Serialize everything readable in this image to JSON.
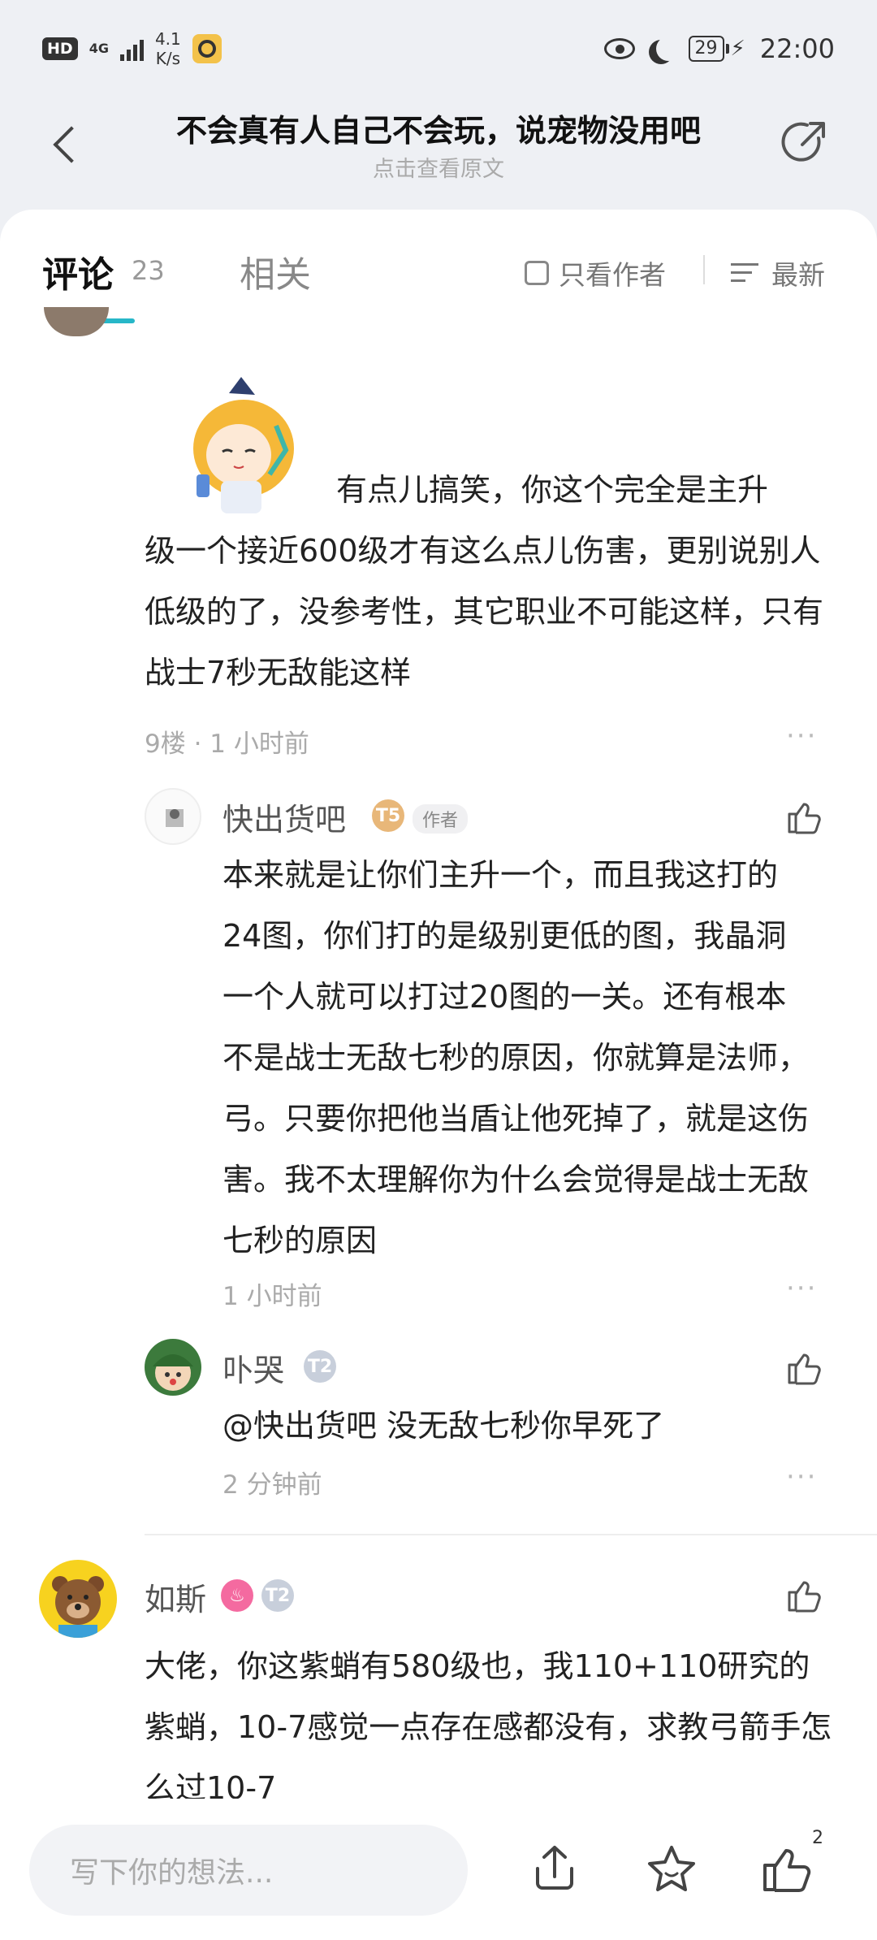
{
  "status": {
    "hd": "HD",
    "network": "4G",
    "speed_value": "4.1",
    "speed_unit": "K/s",
    "battery": "29",
    "time": "22:00"
  },
  "header": {
    "title": "不会真有人自己不会玩，说宠物没用吧",
    "subtitle": "点击查看原文"
  },
  "tabs": {
    "comments_label": "评论",
    "comments_count": "23",
    "related_label": "相关",
    "only_author_label": "只看作者",
    "sort_label": "最新"
  },
  "comment9": {
    "text_line1": "有点儿搞笑，你这个完全是主升",
    "text_rest": "级一个接近600级才有这么点儿伤害，更别说别人低级的了，没参考性，其它职业不可能这样，只有战士7秒无敌能这样",
    "meta": "9楼 · 1 小时前"
  },
  "reply1": {
    "username": "快出货吧",
    "level_badge": "T5",
    "author_badge": "作者",
    "text": "本来就是让你们主升一个，而且我这打的24图，你们打的是级别更低的图，我晶洞一个人就可以打过20图的一关。还有根本不是战士无敌七秒的原因，你就算是法师，弓。只要你把他当盾让他死掉了，就是这伤害。我不太理解你为什么会觉得是战士无敌七秒的原因",
    "meta": "1 小时前"
  },
  "reply2": {
    "username": "卟哭",
    "level_badge": "T2",
    "text": "@快出货吧  没无敌七秒你早死了",
    "meta": "2 分钟前"
  },
  "comment10": {
    "username": "如斯",
    "level_badge": "T2",
    "text": "大佬，你这紫蛸有580级也，我110+110研究的紫蛸，10-7感觉一点存在感都没有，求教弓箭手怎么过10-7"
  },
  "bottom": {
    "input_placeholder": "写下你的想法...",
    "like_count": "2"
  },
  "colors": {
    "accent": "#27b7c8",
    "text": "#222222",
    "muted": "#aaaaaa"
  }
}
